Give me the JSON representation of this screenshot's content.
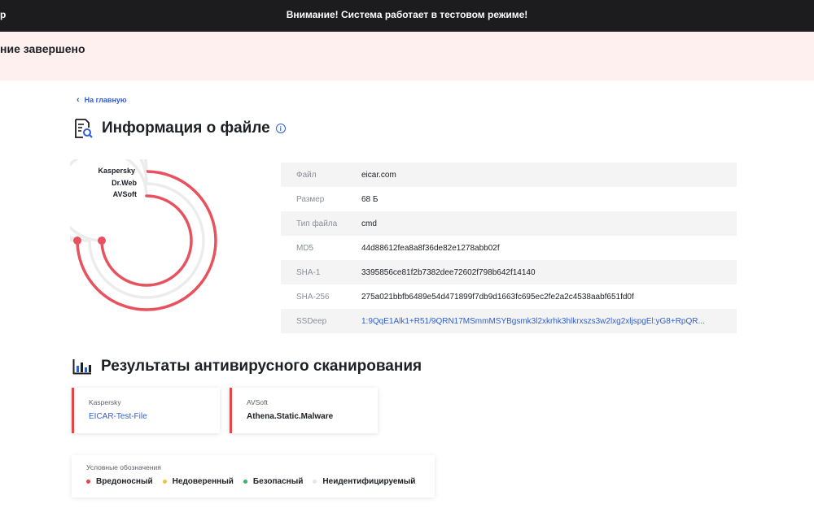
{
  "topbar": {
    "brand_fragment": "р",
    "warning": "Внимание! Система работает в тестовом режиме!"
  },
  "alert": {
    "text": "ние завершено"
  },
  "nav": {
    "back_label": "На главную"
  },
  "file_section": {
    "title": "Информация о файле",
    "info_icon_glyph": "i"
  },
  "engines_chart": {
    "labels": [
      "Kaspersky",
      "Dr.Web",
      "AVSoft"
    ],
    "colors": {
      "malicious": "#e8525f",
      "unidentified": "#ececec"
    }
  },
  "file_info": {
    "rows": [
      {
        "key": "Файл",
        "value": "eicar.com"
      },
      {
        "key": "Размер",
        "value": "68 Б"
      },
      {
        "key": "Тип файла",
        "value": "cmd"
      },
      {
        "key": "MD5",
        "value": "44d88612fea8a8f36de82e1278abb02f"
      },
      {
        "key": "SHA-1",
        "value": "3395856ce81f2b7382dee72602f798b642f14140"
      },
      {
        "key": "SHA-256",
        "value": "275a021bbfb6489e54d471899f7db9d1663fc695ec2fe2a2c4538aabf651fd0f"
      },
      {
        "key": "SSDeep",
        "value": "1:9QqE1Alk1+R51/9QRN17MSmmMSYBgsmk3l2xkrhk3hlkrxszs3w2lxg2xljspgEl:yG8+RpQR..."
      }
    ]
  },
  "results_section": {
    "title": "Результаты антивирусного сканирования",
    "cards": [
      {
        "engine": "Kaspersky",
        "result": "EICAR-Test-File"
      },
      {
        "engine": "AVSoft",
        "result": "Athena.Static.Malware"
      }
    ]
  },
  "legend": {
    "title": "Условные обозначения",
    "items": [
      {
        "label": "Вредоносный",
        "color": "#e84545"
      },
      {
        "label": "Недоверенный",
        "color": "#f5c04a"
      },
      {
        "label": "Безопасный",
        "color": "#34b36b"
      },
      {
        "label": "Неидентифицируемый",
        "color": "#e6e6e6"
      }
    ]
  }
}
